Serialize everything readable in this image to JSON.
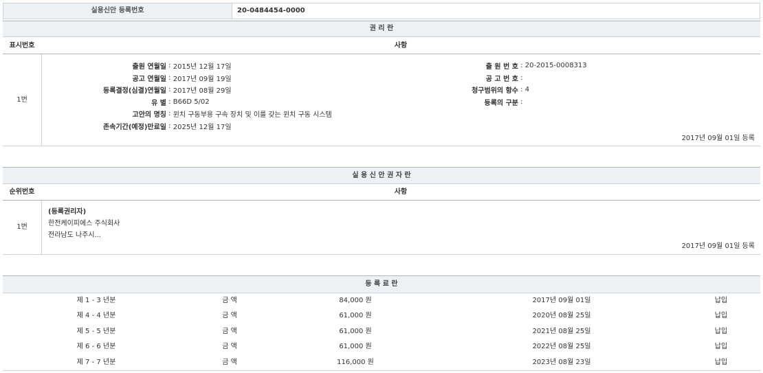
{
  "reg_header": {
    "label": "실용신안 등록번호",
    "value": "20-0484454-0000"
  },
  "rights": {
    "title": "권 리 란",
    "col_no": "표시번호",
    "col_item": "사항",
    "row_no": "1번",
    "left": [
      {
        "label": "출원 연월일",
        "value": "2015년 12월 17일"
      },
      {
        "label": "공고 연월일",
        "value": "2017년 09월 19일"
      },
      {
        "label": "등록결정(심결)연월일",
        "value": "2017년 08월 29일"
      },
      {
        "label": "유 별",
        "value": "B66D 5/02"
      },
      {
        "label": "고안의 명칭",
        "value": "윈치 구동부용 구속 장치 및 이를 갖는 윈치 구동 시스템"
      },
      {
        "label": "존속기간(예정)만료일",
        "value": "2025년 12월 17일"
      }
    ],
    "right": [
      {
        "label": "출 원 번 호",
        "value": "20-2015-0008313"
      },
      {
        "label": "공 고 번 호",
        "value": ""
      },
      {
        "label": "청구범위의 항수",
        "value": "4"
      },
      {
        "label": "등록의 구분",
        "value": ""
      }
    ],
    "reg_date": "2017년 09월 01일 등록"
  },
  "owners": {
    "title": "실 용 신 안 권 자 란",
    "col_no": "순위번호",
    "col_item": "사항",
    "row_no": "1번",
    "type": "(등록권리자)",
    "name": "한전케이피에스 주식회사",
    "address": "전라남도 나주시...",
    "reg_date": "2017년 09월 01일 등록"
  },
  "fees": {
    "title": "등 록 료 란",
    "rows": [
      {
        "period": "제 1 - 3 년분",
        "label": "금 액",
        "amount": "84,000 원",
        "date": "2017년 09월 01일",
        "status": "납입"
      },
      {
        "period": "제 4 - 4 년분",
        "label": "금 액",
        "amount": "61,000 원",
        "date": "2020년 08월 25일",
        "status": "납입"
      },
      {
        "period": "제 5 - 5 년분",
        "label": "금 액",
        "amount": "61,000 원",
        "date": "2021년 08월 25일",
        "status": "납입"
      },
      {
        "period": "제 6 - 6 년분",
        "label": "금 액",
        "amount": "61,000 원",
        "date": "2022년 08월 25일",
        "status": "납입"
      },
      {
        "period": "제 7 - 7 년분",
        "label": "금 액",
        "amount": "116,000 원",
        "date": "2023년 08월 23일",
        "status": "납입"
      }
    ]
  }
}
